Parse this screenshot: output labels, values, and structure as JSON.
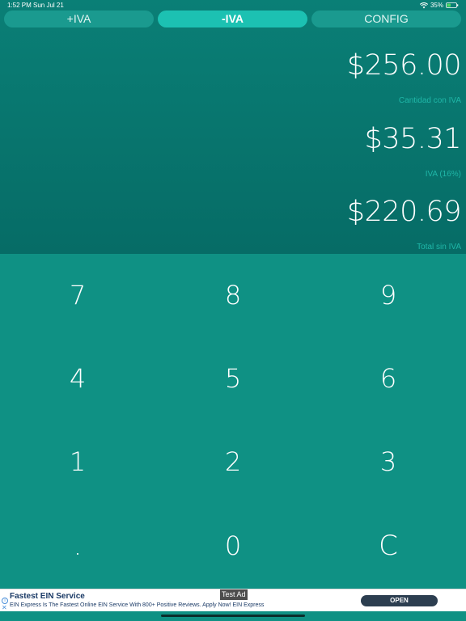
{
  "status_bar": {
    "time": "1:52 PM",
    "date": "Sun Jul 21",
    "battery": "35%",
    "icons": [
      "wifi-icon",
      "battery-icon"
    ]
  },
  "tabs": [
    {
      "label": "+IVA",
      "active": false
    },
    {
      "label": "-IVA",
      "active": true
    },
    {
      "label": "CONFIG",
      "active": false
    }
  ],
  "display": {
    "amount_with_tax": "$256.00",
    "amount_with_tax_label": "Cantidad con IVA",
    "tax_amount": "$35.31",
    "tax_label": "IVA (16%)",
    "total_without_tax": "$220.69",
    "total_without_tax_label": "Total sin IVA"
  },
  "keypad": {
    "keys": [
      "7",
      "8",
      "9",
      "4",
      "5",
      "6",
      "1",
      "2",
      "3",
      ".",
      "0",
      "C"
    ]
  },
  "ad": {
    "badge": "Test Ad",
    "title": "Fastest EIN Service",
    "description": "EIN Express Is The Fastest Online EIN Service With 800+ Positive Reviews. Apply Now! EIN Express",
    "button_label": "OPEN"
  },
  "colors": {
    "display_bg": "#0a7f76",
    "keypad_bg": "#0f9184",
    "active_tab": "#1cc1b2",
    "inactive_tab": "#1a9a8f",
    "caption": "#1fb7a8"
  }
}
